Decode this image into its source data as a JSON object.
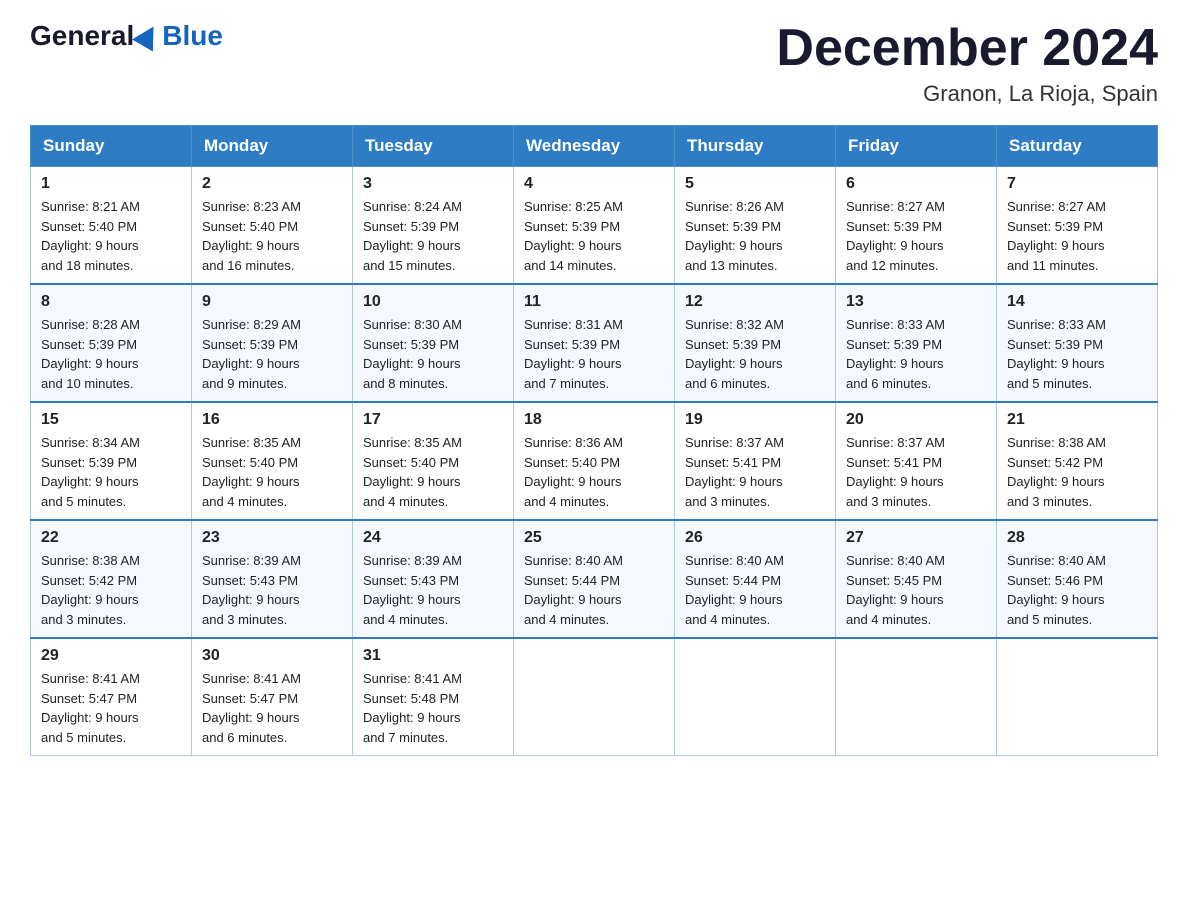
{
  "logo": {
    "general": "General",
    "blue": "Blue"
  },
  "title": "December 2024",
  "subtitle": "Granon, La Rioja, Spain",
  "days_of_week": [
    "Sunday",
    "Monday",
    "Tuesday",
    "Wednesday",
    "Thursday",
    "Friday",
    "Saturday"
  ],
  "weeks": [
    [
      {
        "day": "1",
        "sunrise": "8:21 AM",
        "sunset": "5:40 PM",
        "daylight": "9 hours and 18 minutes."
      },
      {
        "day": "2",
        "sunrise": "8:23 AM",
        "sunset": "5:40 PM",
        "daylight": "9 hours and 16 minutes."
      },
      {
        "day": "3",
        "sunrise": "8:24 AM",
        "sunset": "5:39 PM",
        "daylight": "9 hours and 15 minutes."
      },
      {
        "day": "4",
        "sunrise": "8:25 AM",
        "sunset": "5:39 PM",
        "daylight": "9 hours and 14 minutes."
      },
      {
        "day": "5",
        "sunrise": "8:26 AM",
        "sunset": "5:39 PM",
        "daylight": "9 hours and 13 minutes."
      },
      {
        "day": "6",
        "sunrise": "8:27 AM",
        "sunset": "5:39 PM",
        "daylight": "9 hours and 12 minutes."
      },
      {
        "day": "7",
        "sunrise": "8:27 AM",
        "sunset": "5:39 PM",
        "daylight": "9 hours and 11 minutes."
      }
    ],
    [
      {
        "day": "8",
        "sunrise": "8:28 AM",
        "sunset": "5:39 PM",
        "daylight": "9 hours and 10 minutes."
      },
      {
        "day": "9",
        "sunrise": "8:29 AM",
        "sunset": "5:39 PM",
        "daylight": "9 hours and 9 minutes."
      },
      {
        "day": "10",
        "sunrise": "8:30 AM",
        "sunset": "5:39 PM",
        "daylight": "9 hours and 8 minutes."
      },
      {
        "day": "11",
        "sunrise": "8:31 AM",
        "sunset": "5:39 PM",
        "daylight": "9 hours and 7 minutes."
      },
      {
        "day": "12",
        "sunrise": "8:32 AM",
        "sunset": "5:39 PM",
        "daylight": "9 hours and 6 minutes."
      },
      {
        "day": "13",
        "sunrise": "8:33 AM",
        "sunset": "5:39 PM",
        "daylight": "9 hours and 6 minutes."
      },
      {
        "day": "14",
        "sunrise": "8:33 AM",
        "sunset": "5:39 PM",
        "daylight": "9 hours and 5 minutes."
      }
    ],
    [
      {
        "day": "15",
        "sunrise": "8:34 AM",
        "sunset": "5:39 PM",
        "daylight": "9 hours and 5 minutes."
      },
      {
        "day": "16",
        "sunrise": "8:35 AM",
        "sunset": "5:40 PM",
        "daylight": "9 hours and 4 minutes."
      },
      {
        "day": "17",
        "sunrise": "8:35 AM",
        "sunset": "5:40 PM",
        "daylight": "9 hours and 4 minutes."
      },
      {
        "day": "18",
        "sunrise": "8:36 AM",
        "sunset": "5:40 PM",
        "daylight": "9 hours and 4 minutes."
      },
      {
        "day": "19",
        "sunrise": "8:37 AM",
        "sunset": "5:41 PM",
        "daylight": "9 hours and 3 minutes."
      },
      {
        "day": "20",
        "sunrise": "8:37 AM",
        "sunset": "5:41 PM",
        "daylight": "9 hours and 3 minutes."
      },
      {
        "day": "21",
        "sunrise": "8:38 AM",
        "sunset": "5:42 PM",
        "daylight": "9 hours and 3 minutes."
      }
    ],
    [
      {
        "day": "22",
        "sunrise": "8:38 AM",
        "sunset": "5:42 PM",
        "daylight": "9 hours and 3 minutes."
      },
      {
        "day": "23",
        "sunrise": "8:39 AM",
        "sunset": "5:43 PM",
        "daylight": "9 hours and 3 minutes."
      },
      {
        "day": "24",
        "sunrise": "8:39 AM",
        "sunset": "5:43 PM",
        "daylight": "9 hours and 4 minutes."
      },
      {
        "day": "25",
        "sunrise": "8:40 AM",
        "sunset": "5:44 PM",
        "daylight": "9 hours and 4 minutes."
      },
      {
        "day": "26",
        "sunrise": "8:40 AM",
        "sunset": "5:44 PM",
        "daylight": "9 hours and 4 minutes."
      },
      {
        "day": "27",
        "sunrise": "8:40 AM",
        "sunset": "5:45 PM",
        "daylight": "9 hours and 4 minutes."
      },
      {
        "day": "28",
        "sunrise": "8:40 AM",
        "sunset": "5:46 PM",
        "daylight": "9 hours and 5 minutes."
      }
    ],
    [
      {
        "day": "29",
        "sunrise": "8:41 AM",
        "sunset": "5:47 PM",
        "daylight": "9 hours and 5 minutes."
      },
      {
        "day": "30",
        "sunrise": "8:41 AM",
        "sunset": "5:47 PM",
        "daylight": "9 hours and 6 minutes."
      },
      {
        "day": "31",
        "sunrise": "8:41 AM",
        "sunset": "5:48 PM",
        "daylight": "9 hours and 7 minutes."
      },
      null,
      null,
      null,
      null
    ]
  ],
  "labels": {
    "sunrise": "Sunrise:",
    "sunset": "Sunset:",
    "daylight": "Daylight:"
  }
}
